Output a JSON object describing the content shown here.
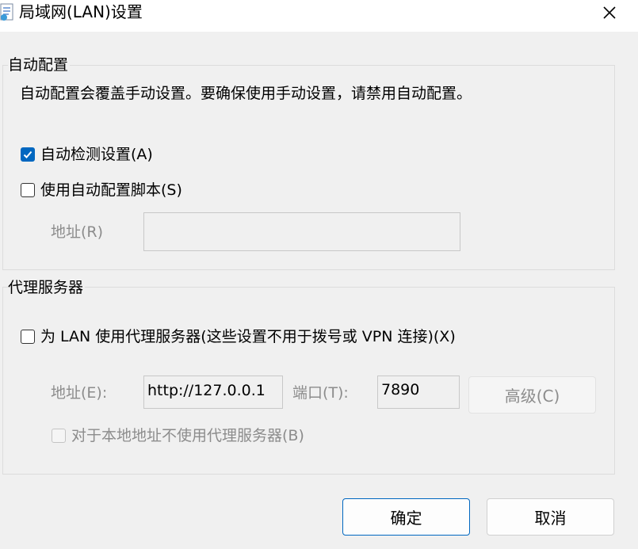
{
  "window": {
    "title": "局域网(LAN)设置",
    "close_label": "✕"
  },
  "auto_config": {
    "group_title": "自动配置",
    "description": "自动配置会覆盖手动设置。要确保使用手动设置，请禁用自动配置。",
    "auto_detect": {
      "label": "自动检测设置(A)",
      "checked": true
    },
    "use_script": {
      "label": "使用自动配置脚本(S)",
      "checked": false
    },
    "address_label": "地址(R)",
    "address_value": ""
  },
  "proxy": {
    "group_title": "代理服务器",
    "use_proxy": {
      "label": "为 LAN 使用代理服务器(这些设置不用于拨号或 VPN 连接)(X)",
      "checked": false
    },
    "address_label": "地址(E):",
    "address_value": "http://127.0.0.1",
    "port_label": "端口(T):",
    "port_value": "7890",
    "advanced_label": "高级(C)",
    "bypass_local": {
      "label": "对于本地地址不使用代理服务器(B)",
      "checked": false
    }
  },
  "buttons": {
    "ok_label": "确定",
    "cancel_label": "取消"
  },
  "colors": {
    "accent": "#0067c0",
    "background": "#f0f0f0",
    "disabled_text": "#8c8c8c"
  }
}
